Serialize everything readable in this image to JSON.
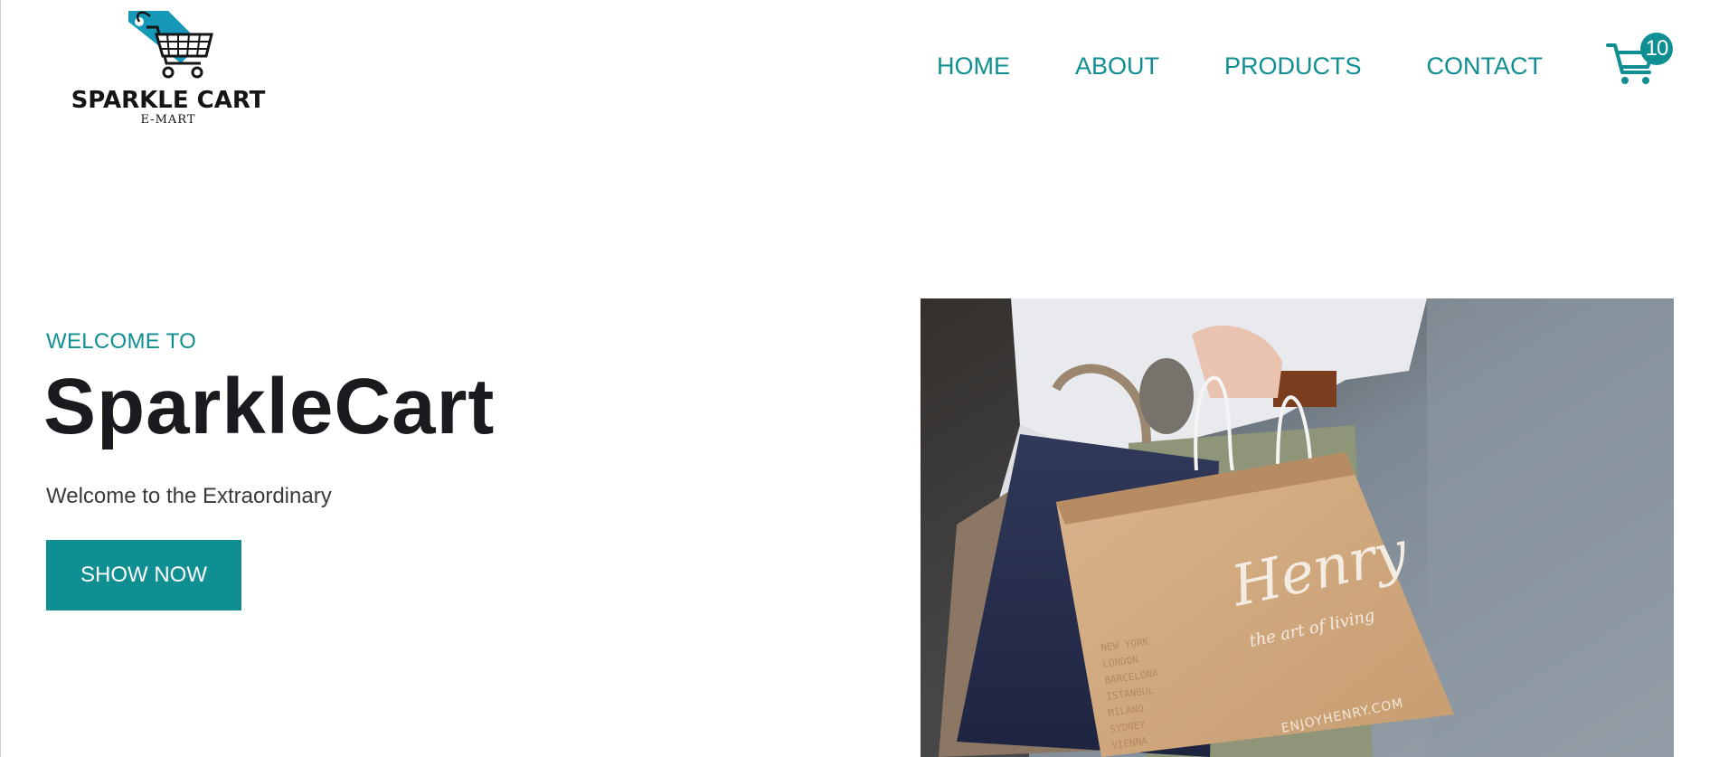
{
  "brand": {
    "name": "SPARKLE CART",
    "tagline": "E-MART"
  },
  "nav": {
    "items": [
      {
        "label": "HOME"
      },
      {
        "label": "ABOUT"
      },
      {
        "label": "PRODUCTS"
      },
      {
        "label": "CONTACT"
      }
    ]
  },
  "cart": {
    "count": "10",
    "icon": "cart-icon"
  },
  "hero": {
    "eyebrow": "WELCOME TO",
    "title": "SparkleCart",
    "subtitle": "Welcome to the Extraordinary",
    "cta_label": "SHOW NOW",
    "image": {
      "bag_brand": "Henry",
      "bag_slogan": "the art of living",
      "bag_url": "ENJOYHENRY.COM",
      "bag_cities": [
        "NEW YORK",
        "LONDON",
        "BARCELONA",
        "ISTANBUL",
        "MILANO",
        "SYDNEY",
        "VIENNA"
      ]
    }
  },
  "colors": {
    "accent": "#0f8f91",
    "text_dark": "#1b1b1f",
    "text_body": "#3a3a3a"
  }
}
